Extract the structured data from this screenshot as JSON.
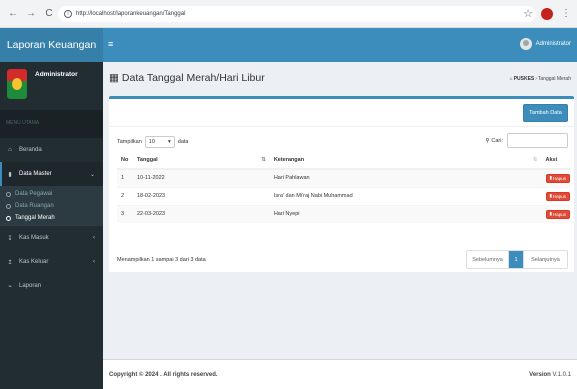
{
  "browser": {
    "back": "←",
    "forward": "→",
    "reload": "C",
    "url": "http://localhost/laporankeuangan/Tanggal"
  },
  "header": {
    "logo": "Laporan Keuangan",
    "hamburger": "≡",
    "user": "Administrator"
  },
  "sidebar": {
    "user_name": "Administrator",
    "menu_header": "MENU UTAMA",
    "items": [
      {
        "label": "Beranda",
        "icon": "home-icon"
      },
      {
        "label": "Data Master",
        "icon": "file-icon",
        "expanded": true,
        "children": [
          {
            "label": "Data Pegawai"
          },
          {
            "label": "Data Ruangan"
          },
          {
            "label": "Tanggal Merah",
            "active": true
          }
        ]
      },
      {
        "label": "Kas Masuk",
        "icon": "download-icon"
      },
      {
        "label": "Kas Keluar",
        "icon": "upload-icon"
      },
      {
        "label": "Laporan",
        "icon": "chart-icon"
      }
    ]
  },
  "page": {
    "title": "Data Tanggal Merah/Hari Libur",
    "breadcrumb": {
      "home": "PUSKES",
      "sep": "›",
      "current": "Tanggal Merah"
    }
  },
  "box": {
    "add_button": "Tambah Data",
    "length_label_pre": "Tampilkan",
    "length_value": "10",
    "length_label_post": "data",
    "search_label": "Cari:",
    "columns": {
      "no": "No",
      "tanggal": "Tanggal",
      "keterangan": "Keterangan",
      "aksi": "Aksi"
    },
    "rows": [
      {
        "no": "1",
        "tanggal": "10-11-2022",
        "keterangan": "Hari Pahlawan",
        "aksi": "Hapus"
      },
      {
        "no": "2",
        "tanggal": "18-02-2023",
        "keterangan": "Isra' dan Mi'raj Nabi Muhammad",
        "aksi": "Hapus"
      },
      {
        "no": "3",
        "tanggal": "22-03-2023",
        "keterangan": "Hari Nyepi",
        "aksi": "Hapus"
      }
    ],
    "info": "Menampilkan 1 sampai 3 dari 3 data",
    "pager": {
      "prev": "Sebelumnya",
      "current": "1",
      "next": "Selanjutnya"
    }
  },
  "footer": {
    "copyright": "Copyright © 2024 . All rights reserved.",
    "version_label": "Version",
    "version_value": "V.1.0.1"
  },
  "colors": {
    "primary": "#3c8dbc",
    "sidebar": "#222d32",
    "danger": "#dd4b39"
  }
}
